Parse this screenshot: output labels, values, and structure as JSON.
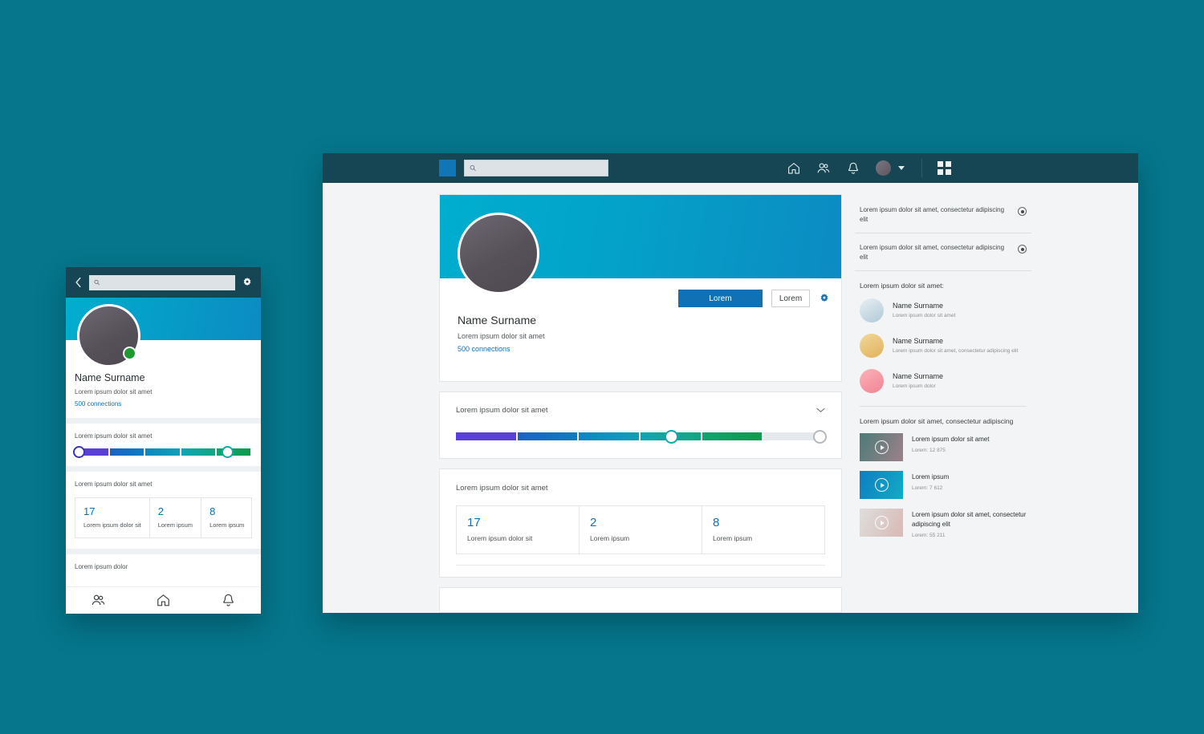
{
  "background_color": "#05768C",
  "desktop": {
    "header": {
      "logo": "logo-square",
      "search_placeholder": "",
      "search_value": "",
      "icons": [
        "home-icon",
        "people-icon",
        "bell-icon",
        "avatar",
        "chevron-down-icon",
        "apps-grid-icon"
      ]
    },
    "profile_card": {
      "name": "Name Surname",
      "headline": "Lorem ipsum dolor sit amet",
      "connections": "500 connections",
      "primary_button": "Lorem",
      "secondary_button": "Lorem",
      "settings_icon": "gear-icon",
      "cover_gradient_from": "#00AECE",
      "cover_gradient_to": "#0C8BC2"
    },
    "slider_card": {
      "title": "Lorem ipsum dolor sit amet",
      "collapse_icon": "chevron-down-icon",
      "segments": [
        "#5B40D6",
        "#1766C4",
        "#0D87C0",
        "#0FA5B4",
        "#11A87E",
        "#0E9A4E",
        "#E3E9ED"
      ],
      "knob_positions": [
        57,
        100
      ]
    },
    "stats_card": {
      "title": "Lorem ipsum dolor sit amet",
      "stats": [
        {
          "value": "17",
          "label": "Lorem ipsum dolor sit"
        },
        {
          "value": "2",
          "label": "Lorem ipsum"
        },
        {
          "value": "8",
          "label": "Lorem ipsum"
        }
      ]
    },
    "sidebar": {
      "notices": [
        {
          "text": "Lorem ipsum dolor sit amet, consectetur adipiscing elit",
          "control": "radio-button"
        },
        {
          "text": "Lorem ipsum dolor sit amet, consectetur adipiscing elit",
          "control": "radio-button"
        }
      ],
      "contacts_heading": "Lorem ipsum dolor sit amet:",
      "contacts": [
        {
          "name": "Name Surname",
          "sub": "Lorem ipsum dolor sit amet",
          "avatar_color": "#C3D7E0"
        },
        {
          "name": "Name Surname",
          "sub": "Lorem ipsum dolor sit amet, consectetur adipiscing elit",
          "avatar_color": "#E7BE6E"
        },
        {
          "name": "Name Surname",
          "sub": "Lorem ipsum dolor",
          "avatar_color": "#F4919E"
        }
      ],
      "videos_heading": "Lorem ipsum dolor sit amet, consectetur adipiscing",
      "videos": [
        {
          "title": "Lorem ipsum dolor sit amet",
          "meta": "Lorem: 12 875",
          "thumb_from": "#4C7B78",
          "thumb_to": "#9D8189"
        },
        {
          "title": "Lorem ipsum",
          "meta": "Lorem: 7 612",
          "thumb_from": "#0C7FC0",
          "thumb_to": "#12A8C4"
        },
        {
          "title": "Lorem ipsum dolor sit amet, consectetur adipiscing elit",
          "meta": "Lorem: 55 211",
          "thumb_from": "#DCDCDC",
          "thumb_to": "#D7B8B4"
        }
      ]
    }
  },
  "mobile": {
    "header": {
      "back_icon": "chevron-left-icon",
      "search_placeholder": "",
      "search_value": "",
      "settings_icon": "gear-icon"
    },
    "profile": {
      "name": "Name Surname",
      "headline": "Lorem ipsum dolor sit amet",
      "connections": "500 connections",
      "online_badge_color": "#1C9B30"
    },
    "slider_card": {
      "title": "Lorem ipsum dolor sit amet"
    },
    "stats_card": {
      "title": "Lorem ipsum dolor sit amet",
      "stats": [
        {
          "value": "17",
          "label": "Lorem ipsum dolor sit"
        },
        {
          "value": "2",
          "label": "Lorem ipsum"
        },
        {
          "value": "8",
          "label": "Lorem ipsum"
        }
      ]
    },
    "last_card": {
      "title": "Lorem ipsum dolor"
    },
    "nav": [
      "people-icon",
      "home-icon",
      "bell-icon"
    ]
  }
}
